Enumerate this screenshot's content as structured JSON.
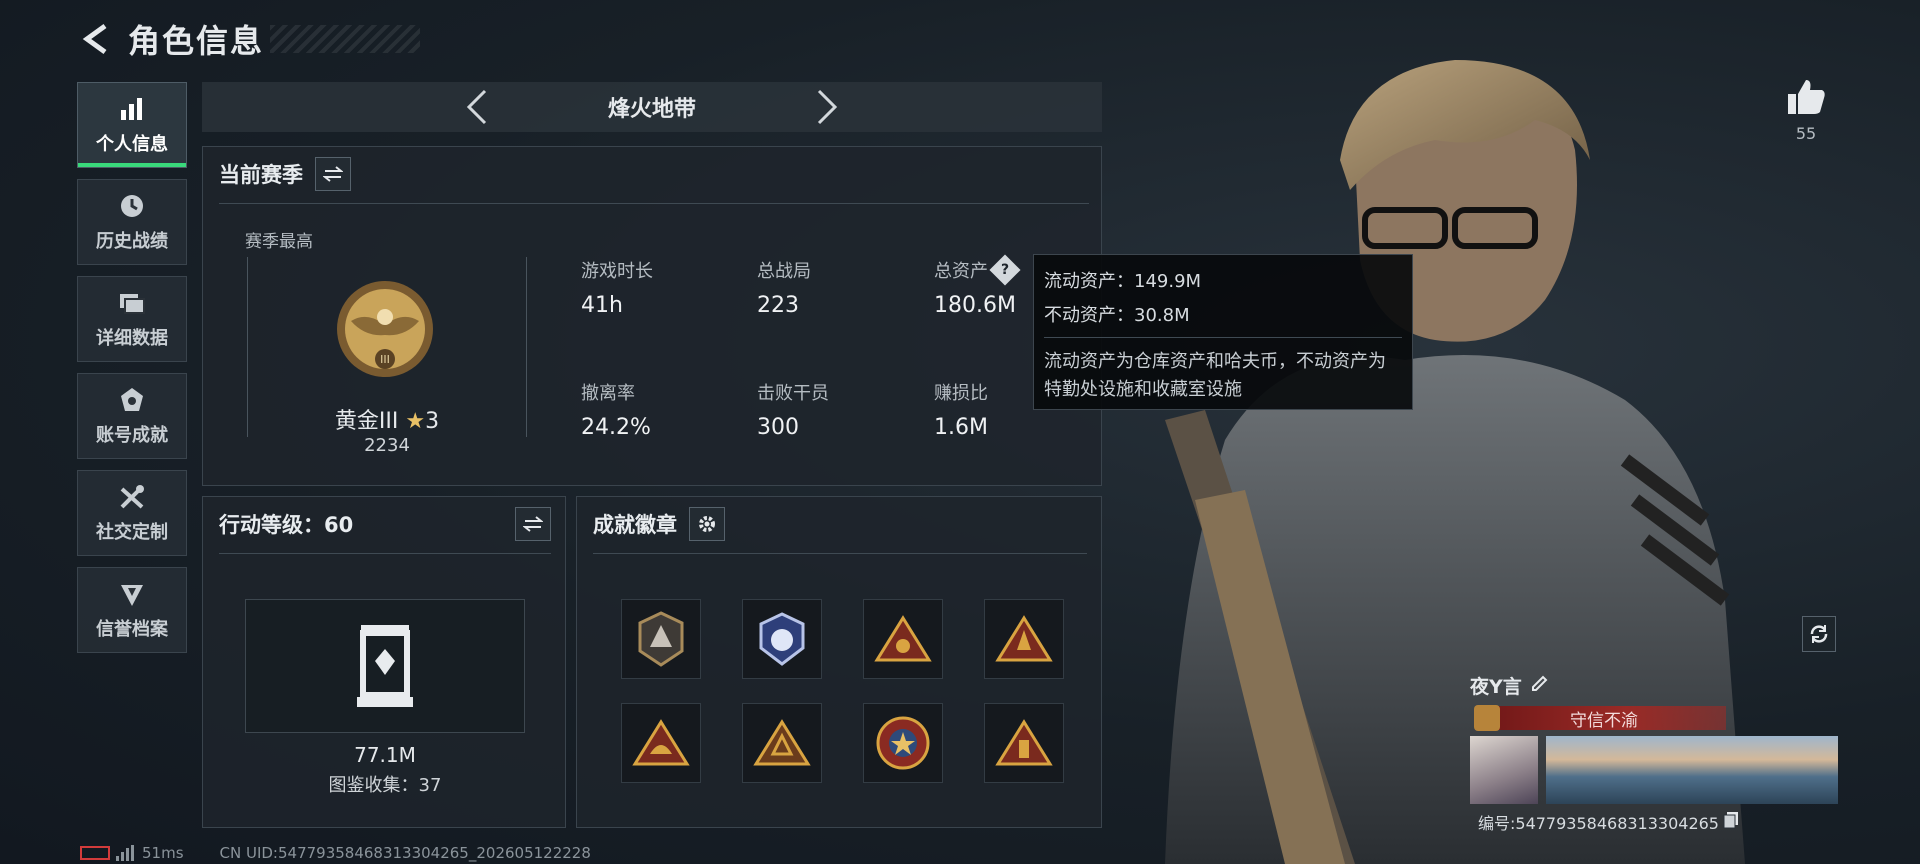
{
  "header": {
    "title": "角色信息"
  },
  "nav": [
    {
      "label": "个人信息",
      "icon": "bar-chart-icon",
      "active": true
    },
    {
      "label": "历史战绩",
      "icon": "history-clock-icon"
    },
    {
      "label": "详细数据",
      "icon": "folders-icon"
    },
    {
      "label": "账号成就",
      "icon": "achievement-icon"
    },
    {
      "label": "社交定制",
      "icon": "tools-icon"
    },
    {
      "label": "信誉档案",
      "icon": "reputation-icon"
    }
  ],
  "season_bar": {
    "name": "烽火地带"
  },
  "current_season": {
    "title": "当前赛季",
    "best_label": "赛季最高",
    "rank_name": "黄金III",
    "rank_stars": "3",
    "rank_score": "2234",
    "stats": [
      {
        "label": "游戏时长",
        "value": "41h"
      },
      {
        "label": "总战局",
        "value": "223"
      },
      {
        "label": "总资产",
        "value": "180.6M"
      },
      {
        "label": "撤离率",
        "value": "24.2%"
      },
      {
        "label": "击败干员",
        "value": "300"
      },
      {
        "label": "赚损比",
        "value": "1.6M"
      }
    ]
  },
  "tooltip": {
    "liquid": "流动资产：149.9M",
    "fixed": "不动资产：30.8M",
    "desc": "流动资产为仓库资产和哈夫币，不动资产为特勤处设施和收藏室设施"
  },
  "action_level": {
    "title": "行动等级：60",
    "value": "77.1M",
    "collection": "图鉴收集：37"
  },
  "badges": {
    "title": "成就徽章"
  },
  "profile": {
    "likes": "55",
    "player_name": "夜Y言",
    "title_tag": "守信不渝",
    "id_text": "编号:5477935846831330426​5"
  },
  "status": {
    "ping": "51ms",
    "uid": "CN UID:54779358468313304265_202605122228"
  },
  "colors": {
    "accent_green": "#39d97b",
    "title_red": "#8a2020",
    "gold": "#c9a45a"
  }
}
